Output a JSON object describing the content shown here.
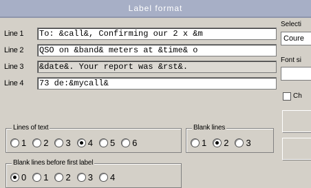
{
  "window": {
    "title": "Label format"
  },
  "lines": [
    {
      "label": "Line 1",
      "text": "To: &call&, Confirming our 2 x &m"
    },
    {
      "label": "Line 2",
      "text": "QSO on &band& meters at &time& o"
    },
    {
      "label": "Line 3",
      "text": "&date&. Your report was &rst&."
    },
    {
      "label": "Line 4",
      "text": "73 de:&mycall&"
    }
  ],
  "lines_of_text": {
    "legend": "Lines of text",
    "options": [
      "1",
      "2",
      "3",
      "4",
      "5",
      "6"
    ],
    "selected": "4"
  },
  "blank_lines": {
    "legend": "Blank lines",
    "options": [
      "1",
      "2",
      "3"
    ],
    "selected": "2"
  },
  "blank_lines_before": {
    "legend": "Blank lines before first label",
    "options": [
      "0",
      "1",
      "2",
      "3",
      "4"
    ],
    "selected": "0"
  },
  "side_panel": {
    "select_label": "Selecti",
    "font_select_value": "Coure",
    "font_size_label": "Font si",
    "checkbox_label": "Ch"
  }
}
